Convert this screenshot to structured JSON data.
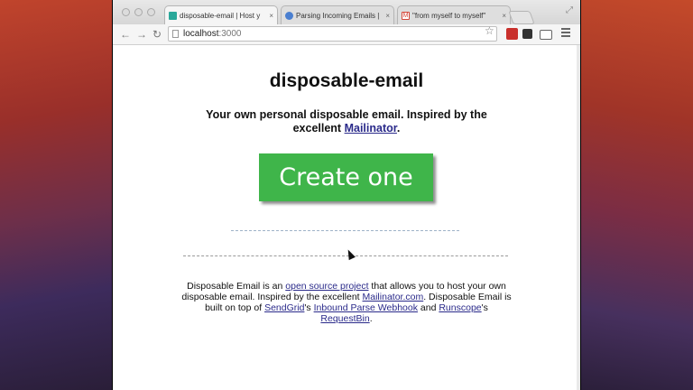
{
  "browser": {
    "tabs": [
      {
        "label": "disposable-email | Host y",
        "favicon_color": "#2aa89a"
      },
      {
        "label": "Parsing Incoming Emails |",
        "favicon_color": "#4a7fd0"
      },
      {
        "label": "\"from myself to myself\"",
        "favicon_color": "#d44638"
      }
    ],
    "tab_close": "×",
    "address": {
      "host": "localhost",
      "port": ":3000"
    }
  },
  "page": {
    "title": "disposable-email",
    "tagline_prefix": "Your own personal disposable email. Inspired by the excellent ",
    "tagline_link": "Mailinator",
    "tagline_suffix": ".",
    "create_button": "Create one",
    "footer": {
      "t1": "Disposable Email is an ",
      "l1": "open source project",
      "t2": " that allows you to host your own disposable email. Inspired by the excellent ",
      "l2": "Mailinator.com",
      "t3": ". Disposable Email is built on top of ",
      "l3": "SendGrid",
      "t4": "'s ",
      "l4": "Inbound Parse Webhook",
      "t5": " and ",
      "l5": "Runscope",
      "t6": "'s ",
      "l6": "RequestBin",
      "t7": "."
    }
  },
  "colors": {
    "button_green": "#3fb54a",
    "link": "#2a2a8a"
  }
}
